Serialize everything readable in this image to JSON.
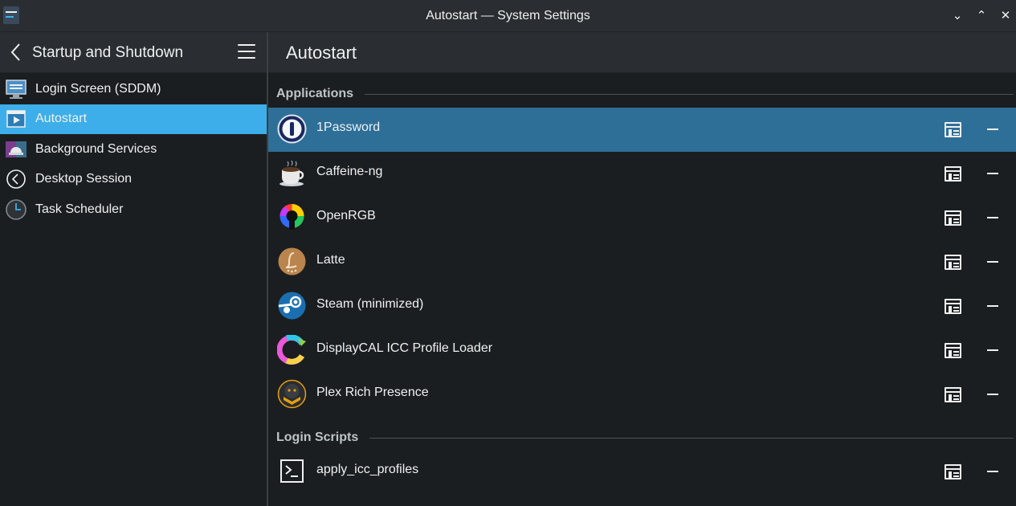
{
  "window": {
    "title": "Autostart — System Settings"
  },
  "titlebar_buttons": {
    "minimize": "⌄",
    "maximize": "⌃",
    "close": "✕"
  },
  "sidebar": {
    "title": "Startup and Shutdown",
    "items": [
      {
        "label": "Login Screen (SDDM)",
        "icon": "monitor-icon"
      },
      {
        "label": "Autostart",
        "icon": "autostart-icon",
        "active": true
      },
      {
        "label": "Background Services",
        "icon": "background-services-icon"
      },
      {
        "label": "Desktop Session",
        "icon": "desktop-session-icon"
      },
      {
        "label": "Task Scheduler",
        "icon": "clock-icon"
      }
    ]
  },
  "main": {
    "title": "Autostart",
    "sections": {
      "applications": "Applications",
      "login_scripts": "Login Scripts"
    },
    "applications": [
      {
        "name": "1Password",
        "icon": "1password-icon",
        "selected": true
      },
      {
        "name": "Caffeine-ng",
        "icon": "coffee-cup-icon"
      },
      {
        "name": "OpenRGB",
        "icon": "openrgb-icon"
      },
      {
        "name": "Latte",
        "icon": "latte-icon"
      },
      {
        "name": "Steam (minimized)",
        "icon": "steam-icon"
      },
      {
        "name": "DisplayCAL ICC Profile Loader",
        "icon": "displaycal-icon"
      },
      {
        "name": "Plex Rich Presence",
        "icon": "plex-icon"
      }
    ],
    "login_scripts": [
      {
        "name": "apply_icc_profiles",
        "icon": "terminal-icon"
      }
    ]
  },
  "colors": {
    "accent": "#3daee9",
    "selection": "#2e6f98",
    "background": "#1b1e20",
    "header": "#2a2e32"
  }
}
